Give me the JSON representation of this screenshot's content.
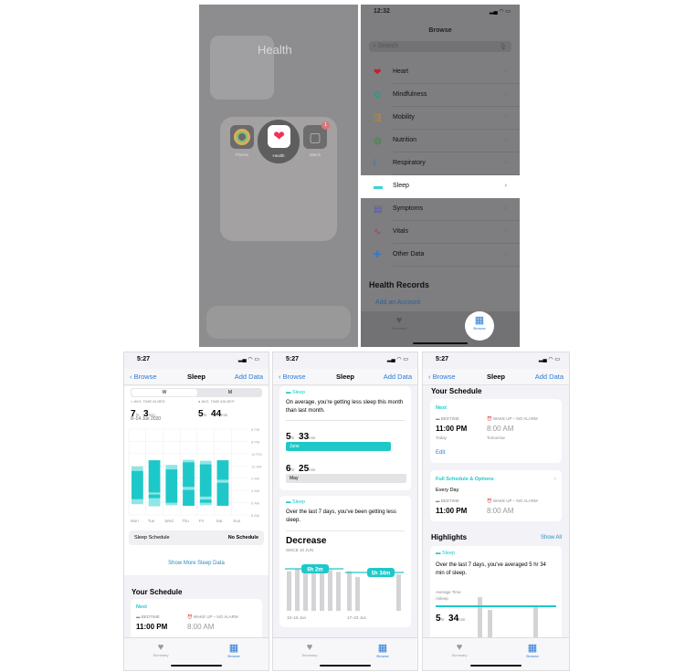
{
  "home_screen": {
    "folder_title": "Health",
    "apps": [
      {
        "label": "Fitness",
        "icon": "activity-rings-icon"
      },
      {
        "label": "Health",
        "icon": "heart-icon"
      },
      {
        "label": "Watch",
        "icon": "watch-icon",
        "badge": "1"
      }
    ]
  },
  "browse": {
    "time": "12:32",
    "title": "Browse",
    "search_placeholder": "Search",
    "categories": [
      {
        "label": "Heart",
        "icon": "heart-icon",
        "color": "#c2202f",
        "glyph": "❤"
      },
      {
        "label": "Mindfulness",
        "icon": "flower-icon",
        "color": "#2a9a8e",
        "glyph": "✿"
      },
      {
        "label": "Mobility",
        "icon": "arrows-icon",
        "color": "#c9852b",
        "glyph": "⇶"
      },
      {
        "label": "Nutrition",
        "icon": "apple-icon",
        "color": "#3d8c3a",
        "glyph": "◍"
      },
      {
        "label": "Respiratory",
        "icon": "lungs-icon",
        "color": "#2c6fb5",
        "glyph": "⦚"
      },
      {
        "label": "Sleep",
        "icon": "bed-icon",
        "color": "#3fd2d2",
        "glyph": "▬"
      },
      {
        "label": "Symptoms",
        "icon": "clipboard-icon",
        "color": "#5a56b5",
        "glyph": "▤"
      },
      {
        "label": "Vitals",
        "icon": "waveform-icon",
        "color": "#c0304a",
        "glyph": "∿"
      },
      {
        "label": "Other Data",
        "icon": "plus-icon",
        "color": "#2a7ad6",
        "glyph": "✚"
      }
    ],
    "health_records_title": "Health Records",
    "add_account": "Add an Account",
    "tabs": {
      "summary": "Summary",
      "browse": "Browse"
    }
  },
  "sleep_screen": {
    "time": "5:27",
    "back": "Browse",
    "title": "Sleep",
    "add_data": "Add Data",
    "segments": [
      "W",
      "M"
    ],
    "in_bed_label": "AVG. TIME IN BED",
    "asleep_label": "AVG. TIME ASLEEP",
    "in_bed": {
      "hr": "7",
      "min": "3"
    },
    "asleep": {
      "hr": "5",
      "min": "44"
    },
    "hr_unit": "hr",
    "min_unit": "min",
    "date_range": "8–14 Jun 2020",
    "schedule_label": "Sleep Schedule",
    "schedule_value": "No Schedule",
    "show_more": "Show More Sleep Data",
    "your_schedule": "Your Schedule",
    "next": "Next",
    "bedtime_label": "BEDTIME",
    "wake_label": "WAKE UP – NO ALARM",
    "bedtime": "11:00 PM",
    "wake": "8:00 AM",
    "today": "Today",
    "tomorrow": "Tomorrow",
    "edit": "Edit",
    "full_schedule": "Full Schedule & Options",
    "every_day": "Every Day",
    "highlights": "Highlights",
    "show_all": "Show All",
    "sleep_tag": "Sleep",
    "month_text": "On average, you're getting less sleep this month than last month.",
    "june": {
      "hr": "5",
      "min": "33",
      "label": "June",
      "fraction": 0.87
    },
    "may": {
      "hr": "6",
      "min": "25",
      "label": "May",
      "fraction": 1.0
    },
    "week_text": "Over the last 7 days, you've been getting less sleep.",
    "decrease": "Decrease",
    "since": "SINCE 10 JUN",
    "week1": {
      "label": "10–16 Jun",
      "avg": "6h 2m",
      "bars": [
        6.2,
        6.6,
        6.4,
        6.5,
        6.3,
        6.4,
        6.1
      ]
    },
    "week2": {
      "label": "17–23 Jun",
      "avg": "5h 34m",
      "bars": [
        6.2,
        5.3,
        0,
        0,
        0,
        0,
        5.7
      ]
    },
    "avg_text": "Over the last 7 days, you've averaged 5 hr 34 min of sleep.",
    "avg_label": "Average Time Asleep",
    "avg": {
      "hr": "5",
      "min": "34"
    },
    "tabs": {
      "summary": "Summary",
      "browse": "Browse"
    }
  },
  "chart_data": {
    "type": "bar",
    "title": "",
    "y_ticks": [
      "6 PM",
      "8 PM",
      "10 PM",
      "12 AM",
      "2 AM",
      "4 AM",
      "6 AM",
      "8 AM"
    ],
    "categories": [
      "Mon",
      "Tue",
      "Wed",
      "Thu",
      "Fri",
      "Sat",
      "Sun"
    ],
    "series": [
      {
        "name": "AVG. TIME IN BED",
        "color": "#8fe6e6",
        "ranges": [
          [
            "00:05",
            "06:15"
          ],
          [
            "23:05",
            "06:35"
          ],
          [
            "23:50",
            "06:25"
          ],
          [
            "23:00",
            "06:30"
          ],
          [
            "23:10",
            "06:25"
          ],
          [
            "23:05",
            "06:30"
          ],
          []
        ]
      },
      {
        "name": "AVG. TIME ASLEEP",
        "color": "#1ec8c8",
        "ranges": [
          [
            [
              "00:50",
              "05:25"
            ]
          ],
          [
            [
              "23:05",
              "04:20"
            ],
            [
              "04:40",
              "05:15"
            ]
          ],
          [
            [
              "00:35",
              "06:00"
            ]
          ],
          [
            [
              "23:25",
              "03:25"
            ],
            [
              "03:55",
              "06:30"
            ]
          ],
          [
            [
              "23:45",
              "05:00"
            ],
            [
              "05:30",
              "06:00"
            ]
          ],
          [
            [
              "23:05",
              "02:15"
            ],
            [
              "02:45",
              "06:30"
            ]
          ],
          []
        ]
      }
    ]
  },
  "colors": {
    "accent": "#2a7ad6",
    "sleep": "#1ec8c8"
  }
}
